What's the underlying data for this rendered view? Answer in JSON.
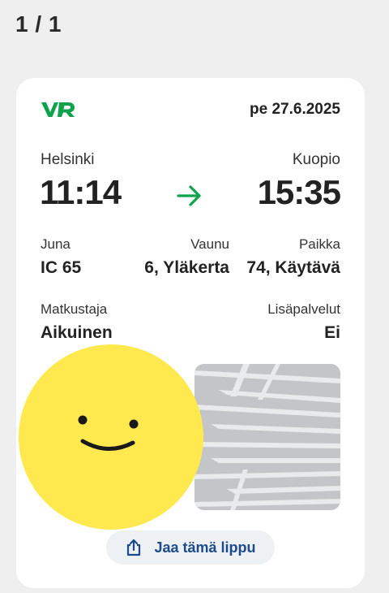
{
  "header": {
    "page_counter": "1 / 1"
  },
  "ticket": {
    "brand": "VR",
    "date": "pe 27.6.2025",
    "from_station": "Helsinki",
    "to_station": "Kuopio",
    "departure_time": "11:14",
    "arrival_time": "15:35",
    "train_label": "Juna",
    "train_value": "IC 65",
    "car_label": "Vaunu",
    "car_value": "6, Yläkerta",
    "seat_label": "Paikka",
    "seat_value": "74, Käytävä",
    "passenger_label": "Matkustaja",
    "passenger_value": "Aikuinen",
    "extras_label": "Lisäpalvelut",
    "extras_value": "Ei"
  },
  "share_button": {
    "label": "Jaa tämä lippu",
    "icon": "share-icon"
  },
  "colors": {
    "brand_green": "#11a34c",
    "qr_background": "#c3c5c8",
    "avatar_yellow": "#ffe94e",
    "button_text": "#1d4a8c"
  }
}
